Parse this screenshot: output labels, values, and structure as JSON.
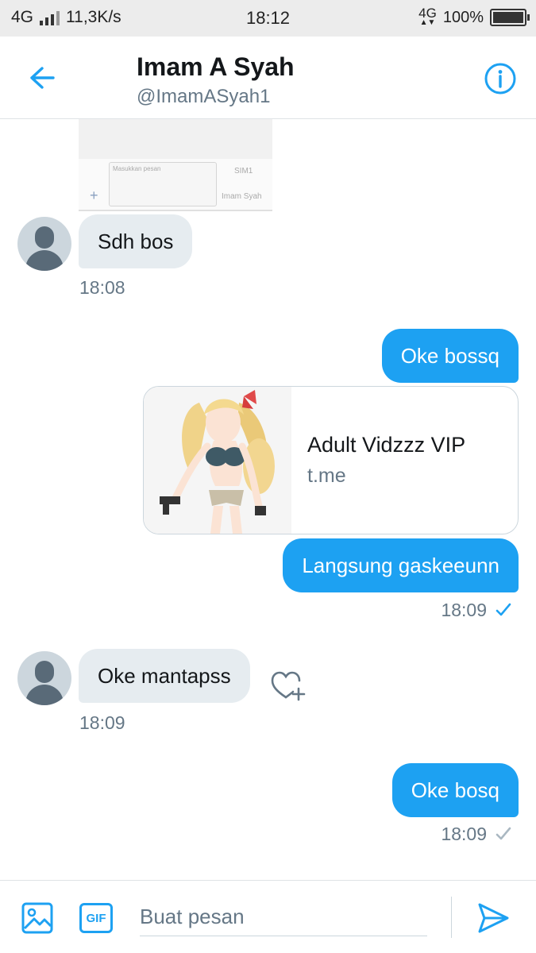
{
  "status_bar": {
    "network": "4G",
    "speed": "11,3K/s",
    "time": "18:12",
    "network_right": "4G",
    "battery": "100%",
    "battery_level": 1.0
  },
  "header": {
    "name": "Imam A Syah",
    "handle": "@ImamASyah1",
    "back_icon": "arrow-left-icon",
    "info_icon": "info-circle-icon"
  },
  "screenshot_preview": {
    "input_placeholder": "Masukkan pesan",
    "sim_label": "SIM1",
    "name_label": "Imam Syah"
  },
  "messages": [
    {
      "direction": "in",
      "text": "Sdh bos",
      "time": "18:08"
    },
    {
      "direction": "out",
      "text": "Oke bossq"
    },
    {
      "direction": "out",
      "type": "link_card",
      "title": "Adult Vidzzz VIP",
      "domain": "t.me"
    },
    {
      "direction": "out",
      "text": "Langsung gaskeeunn",
      "time": "18:09",
      "status": "read"
    },
    {
      "direction": "in",
      "text": "Oke mantapss",
      "time": "18:09"
    },
    {
      "direction": "out",
      "text": "Oke bosq",
      "time": "18:09",
      "status": "sent"
    }
  ],
  "composer": {
    "placeholder": "Buat pesan",
    "gif_label": "GIF",
    "media_icon": "image-icon",
    "send_icon": "send-icon"
  },
  "colors": {
    "accent": "#1da1f2",
    "incoming_bubble": "#e6ecf0",
    "secondary_text": "#657786",
    "status_bar_bg": "#ececec"
  }
}
